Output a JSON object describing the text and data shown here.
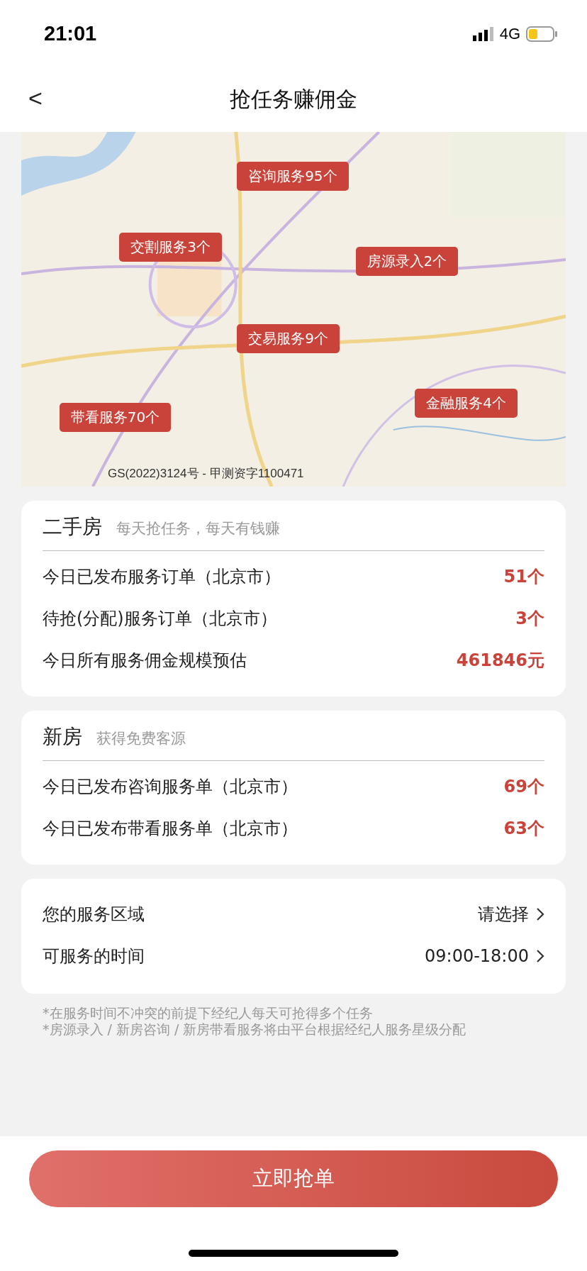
{
  "status_bar": {
    "time": "21:01",
    "network": "4G"
  },
  "nav": {
    "back": "<",
    "title": "抢任务赚佣金"
  },
  "map": {
    "badges": [
      {
        "text": "咨询服务95个"
      },
      {
        "text": "交割服务3个"
      },
      {
        "text": "房源录入2个"
      },
      {
        "text": "交易服务9个"
      },
      {
        "text": "金融服务4个"
      },
      {
        "text": "带看服务70个"
      }
    ],
    "attribution": "GS(2022)3124号 - 甲测资字1100471"
  },
  "cards": [
    {
      "title": "二手房",
      "subtitle": "每天抢任务，每天有钱赚",
      "rows": [
        {
          "label": "今日已发布服务订单（北京市）",
          "value": "51个"
        },
        {
          "label": "待抢(分配)服务订单（北京市）",
          "value": "3个"
        },
        {
          "label": "今日所有服务佣金规模预估",
          "value": "461846元"
        }
      ]
    },
    {
      "title": "新房",
      "subtitle": "获得免费客源",
      "rows": [
        {
          "label": "今日已发布咨询服务单（北京市）",
          "value": "69个"
        },
        {
          "label": "今日已发布带看服务单（北京市）",
          "value": "63个"
        }
      ]
    }
  ],
  "settings": [
    {
      "label": "您的服务区域",
      "value": "请选择"
    },
    {
      "label": "可服务的时间",
      "value": "09:00-18:00"
    }
  ],
  "notes": [
    "*在服务时间不冲突的前提下经纪人每天可抢得多个任务",
    "*房源录入 / 新房咨询 / 新房带看服务将由平台根据经纪人服务星级分配"
  ],
  "action": "立即抢单"
}
